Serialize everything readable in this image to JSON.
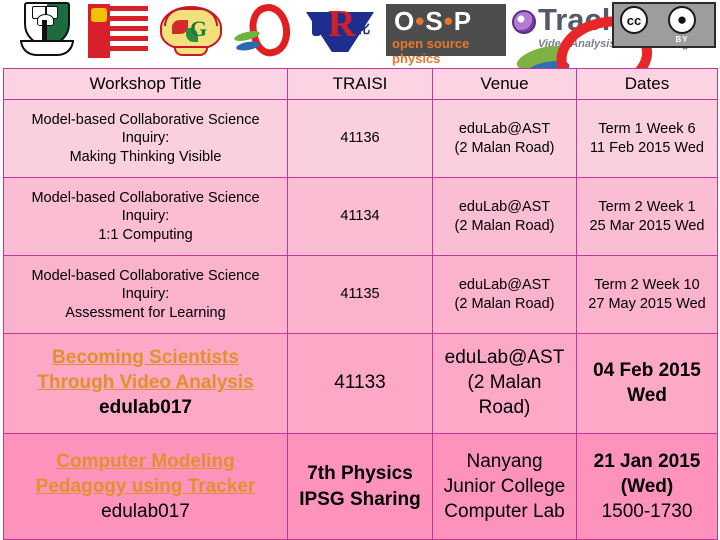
{
  "header": {
    "logos": [
      {
        "name": "nie-crest-logo",
        "alt": "NIE crest"
      },
      {
        "name": "singapore-flag-logo",
        "alt": "flag block"
      },
      {
        "name": "school-fan-crest-logo",
        "alt": "school crest"
      },
      {
        "name": "ast-loop-logo",
        "alt": "AST loop"
      },
      {
        "name": "river-valley-logo",
        "alt": "RV"
      }
    ],
    "osp": {
      "letters": "O·S·P",
      "o": "O",
      "s": "S",
      "p": "P",
      "dot": "•",
      "subtitle": "open source physics"
    },
    "tracker": {
      "title": "Tracker",
      "subtitle": "Video Analysis and Modeling Tool"
    },
    "ccby": {
      "cc": "cc",
      "i": "i",
      "by": "BY"
    }
  },
  "table": {
    "columns": [
      {
        "label": "Workshop Title",
        "bold": false
      },
      {
        "label": "TRAISI",
        "bold": false
      },
      {
        "label": "Venue",
        "bold": true
      },
      {
        "label": "Dates",
        "bold": false
      }
    ],
    "rows": [
      {
        "title_lines": [
          "Model-based Collaborative Science",
          "Inquiry:",
          "Making Thinking Visible"
        ],
        "traisi": "41136",
        "venue_lines": [
          "eduLab@AST",
          "(2 Malan Road)"
        ],
        "date_lines": [
          "Term 1 Week 6",
          "11 Feb 2015 Wed"
        ]
      },
      {
        "title_lines": [
          "Model-based Collaborative Science",
          "Inquiry:",
          "1:1 Computing"
        ],
        "traisi": "41134",
        "venue_lines": [
          "eduLab@AST",
          "(2 Malan Road)"
        ],
        "date_lines": [
          "Term 2 Week 1",
          "25 Mar 2015 Wed"
        ]
      },
      {
        "title_lines": [
          "Model-based Collaborative Science",
          "Inquiry:",
          "Assessment for Learning"
        ],
        "traisi": "41135",
        "venue_lines": [
          "eduLab@AST",
          "(2 Malan Road)"
        ],
        "date_lines": [
          "Term 2 Week 10",
          "27 May 2015 Wed"
        ]
      },
      {
        "link_lines": [
          "Becoming Scientists",
          "Through Video Analysis"
        ],
        "code": "edulab017",
        "traisi": "41133",
        "venue_lines": [
          "eduLab@AST",
          "(2 Malan",
          "Road)"
        ],
        "date_lines": [
          "04 Feb 2015",
          "Wed"
        ]
      },
      {
        "link_lines": [
          "Computer Modeling",
          "Pedagogy using Tracker"
        ],
        "code": "edulab017",
        "traisi_lines": [
          "7th Physics",
          "IPSG Sharing"
        ],
        "venue_lines": [
          "Nanyang",
          "Junior College",
          "Computer Lab"
        ],
        "date_lines": [
          "21 Jan 2015",
          "(Wed)",
          "1500-1730"
        ]
      }
    ]
  },
  "colors": {
    "border": "#c0399a",
    "header_bg": "#fbd3e2",
    "link": "#e0912c",
    "row1": "#fbd0de",
    "row2": "#fbbdd3",
    "row3": "#fbb3cd",
    "row4": "#fda8c6",
    "row5": "#fd93bc"
  }
}
